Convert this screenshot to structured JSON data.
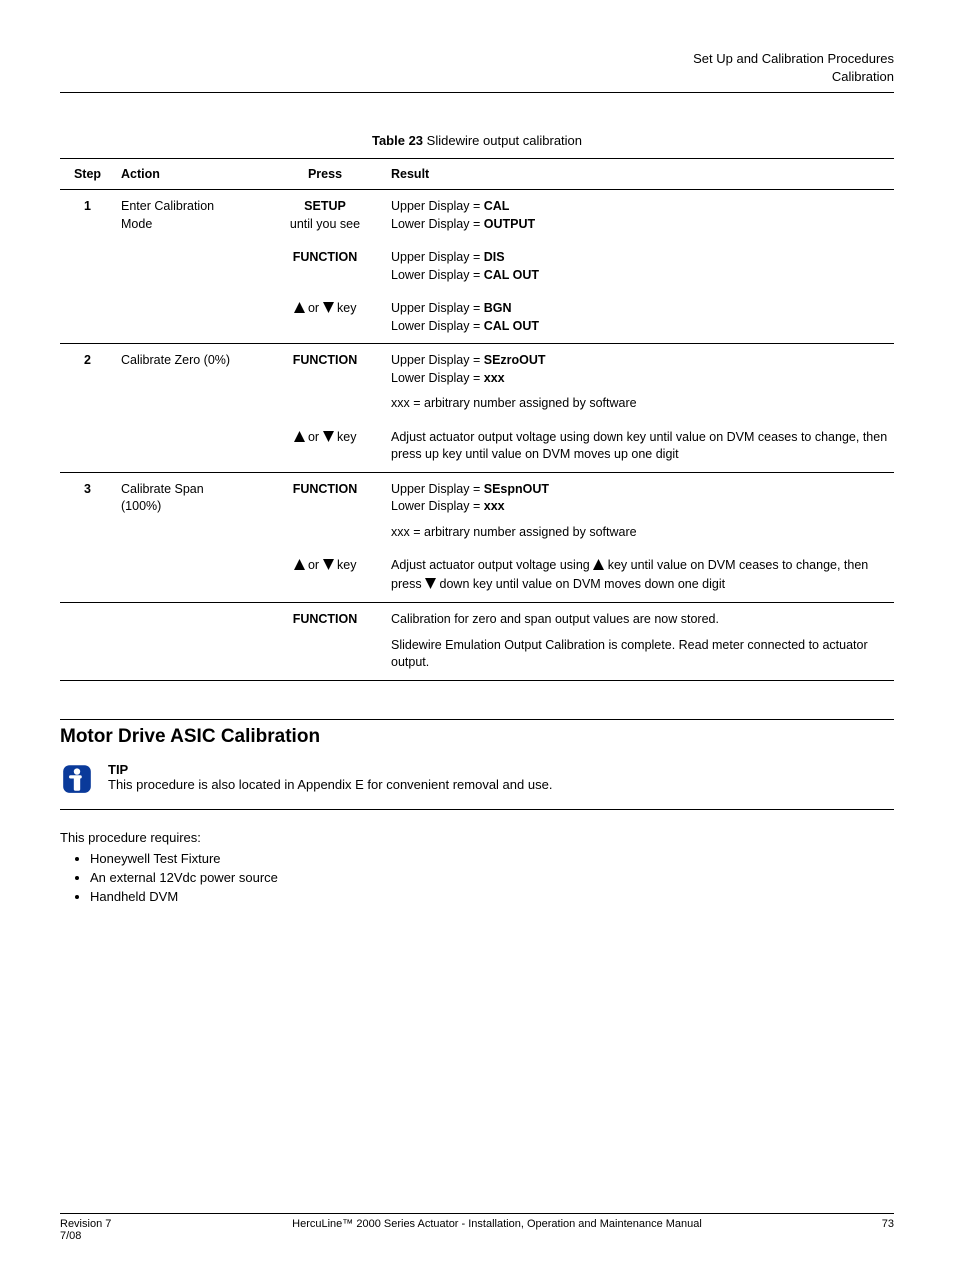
{
  "header": {
    "line1": "Set Up and Calibration Procedures",
    "line2": "Calibration"
  },
  "table_title_prefix": "Table 23 ",
  "table_title": "Slidewire output calibration",
  "columns": [
    "Step",
    "Action",
    "Press",
    "Result"
  ],
  "rows": {
    "r1": {
      "step": "1",
      "action_l1": "Enter Calibration",
      "action_l2": "Mode",
      "press": "SETUP",
      "press_sub": "until you see",
      "res1": "Upper Display = ",
      "res1b": "CAL",
      "res2": "Lower Display = ",
      "res2b": "OUTPUT"
    },
    "r2": {
      "press": "FUNCTION",
      "res1": "Upper Display = ",
      "res1b": "DIS",
      "res2": "Lower Display = ",
      "res2b": "CAL OUT"
    },
    "r3": {
      "press_mid": " or ",
      "press_suffix": " key",
      "res1": "Upper Display = ",
      "res1b": "BGN",
      "res2": "Lower Display = ",
      "res2b": "CAL OUT"
    },
    "r4": {
      "step": "2",
      "action": "Calibrate Zero (0%)",
      "press": "FUNCTION",
      "res1": "Upper Display = ",
      "res1b": "SEzroOUT",
      "res2": "Lower Display  = ",
      "res2b": "xxx",
      "note": "xxx = arbitrary number assigned by software"
    },
    "r5": {
      "press_mid": " or ",
      "press_suffix": " key",
      "text": "Adjust actuator output voltage using down key until  value on DVM ceases to change, then press up key until value on DVM moves up one digit"
    },
    "r6": {
      "step": "3",
      "action_l1": "Calibrate Span",
      "action_l2": "(100%)",
      "press": "FUNCTION",
      "res1": "Upper Display = ",
      "res1b": "SEspnOUT",
      "res2": "Lower Display = ",
      "res2b": "xxx",
      "note": "xxx = arbitrary number assigned by software"
    },
    "r7": {
      "press_mid": " or ",
      "press_suffix": " key",
      "text1": "Adjust actuator output voltage using ",
      "text2": " key until  value on DVM ceases to change, then press ",
      "text3": " down key until value on DVM moves down one digit"
    },
    "r8": {
      "press": "FUNCTION",
      "text1": "Calibration for zero and span output values are now stored.",
      "text2": "Slidewire Emulation Output Calibration is complete. Read meter connected to actuator output."
    }
  },
  "section": {
    "title": "Motor Drive ASIC Calibration",
    "tip_label": "TIP",
    "tip_text": "This procedure is also located in Appendix E for convenient removal and use.",
    "requires_label": "This procedure requires:",
    "bullets": [
      "Honeywell Test Fixture",
      "An external 12Vdc power source",
      "Handheld DVM"
    ]
  },
  "footer": {
    "left_l1": "Revision 7",
    "left_l2": "7/08",
    "center": "HercuLine™ 2000 Series Actuator - Installation, Operation and Maintenance Manual",
    "right": "73"
  }
}
